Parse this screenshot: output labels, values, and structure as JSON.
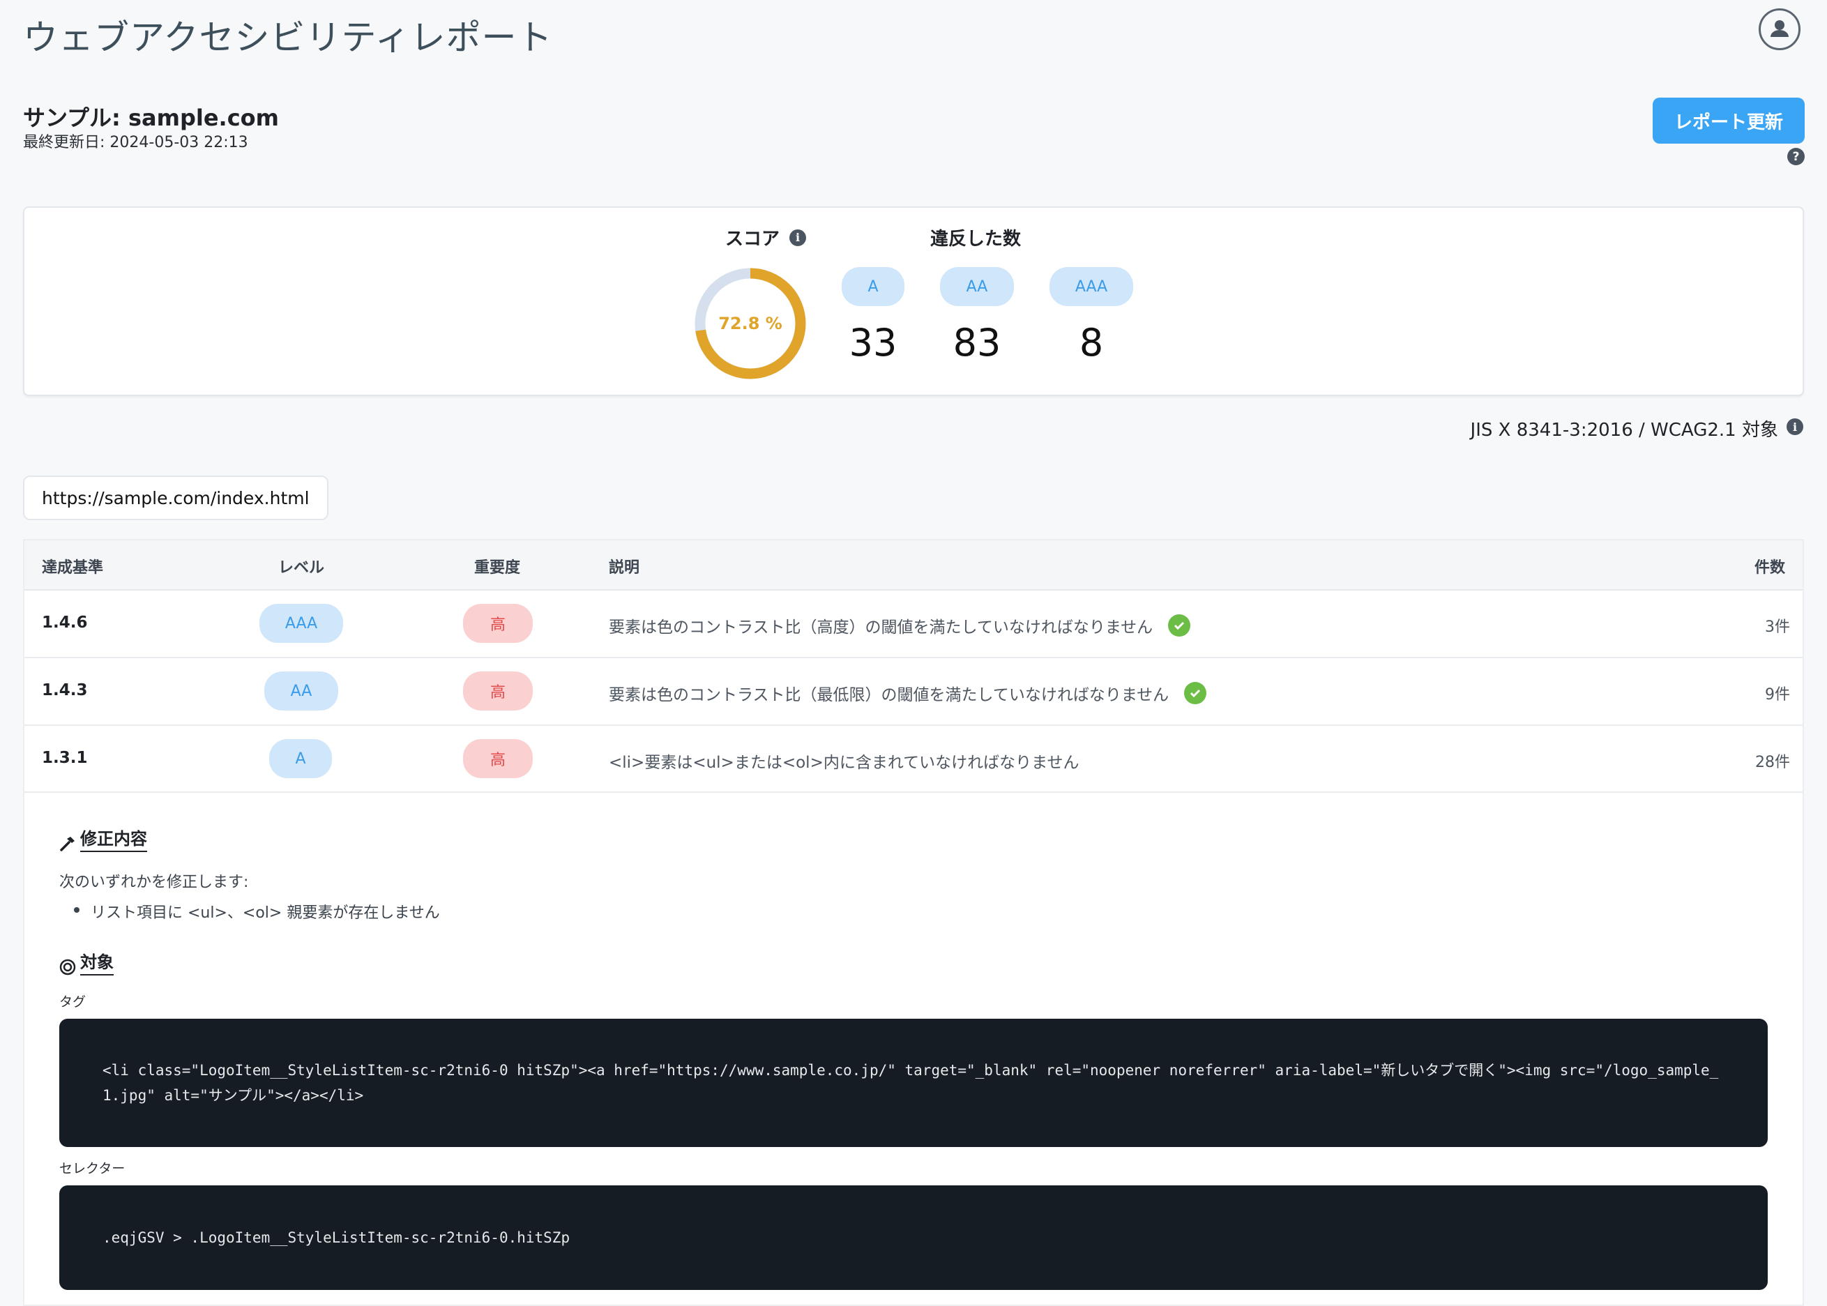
{
  "header": {
    "title": "ウェブアクセシビリティレポート",
    "avatar_icon": "user-icon"
  },
  "site": {
    "name": "サンプル: sample.com",
    "updated": "最終更新日: 2024-05-03 22:13"
  },
  "actions": {
    "refresh_label": "レポート更新",
    "help_glyph": "?"
  },
  "summary": {
    "score_label": "スコア",
    "score_value": "72.8 %",
    "score_fraction": 0.728,
    "violations_label": "違反した数",
    "levels": [
      {
        "level": "A",
        "count": "33"
      },
      {
        "level": "AA",
        "count": "83"
      },
      {
        "level": "AAA",
        "count": "8"
      }
    ],
    "colors": {
      "score_ring": "#e0a42a",
      "score_track": "#d5dfee",
      "pill_bg": "#cfe6fb",
      "pill_text": "#3a9be8"
    }
  },
  "standard": "JIS X 8341-3:2016 / WCAG2.1 対象",
  "url_tab": "https://sample.com/index.html",
  "table": {
    "headers": {
      "criterion": "達成基準",
      "level": "レベル",
      "severity": "重要度",
      "description": "説明",
      "count": "件数"
    },
    "rows": [
      {
        "criterion": "1.4.6",
        "level": "AAA",
        "severity": "高",
        "description": "要素は色のコントラスト比（高度）の閾値を満たしていなければなりません",
        "checked": true,
        "count": "3件"
      },
      {
        "criterion": "1.4.3",
        "level": "AA",
        "severity": "高",
        "description": "要素は色のコントラスト比（最低限）の閾値を満たしていなければなりません",
        "checked": true,
        "count": "9件"
      },
      {
        "criterion": "1.3.1",
        "level": "A",
        "severity": "高",
        "description": "<li>要素は<ul>または<ol>内に含まれていなければなりません",
        "checked": false,
        "count": "28件"
      }
    ]
  },
  "detail": {
    "fix_title": "修正内容",
    "fix_intro": "次のいずれかを修正します:",
    "fix_items": [
      "リスト項目に <ul>、<ol> 親要素が存在しません"
    ],
    "target_title": "対象",
    "tag_label": "タグ",
    "tag_code": "<li class=\"LogoItem__StyleListItem-sc-r2tni6-0 hitSZp\"><a href=\"https://www.sample.co.jp/\" target=\"_blank\" rel=\"noopener noreferrer\" aria-label=\"新しいタブで開く\"><img src=\"/logo_sample_1.jpg\" alt=\"サンプル\"></a></li>",
    "selector_label": "セレクター",
    "selector_code": ".eqjGSV > .LogoItem__StyleListItem-sc-r2tni6-0.hitSZp"
  }
}
